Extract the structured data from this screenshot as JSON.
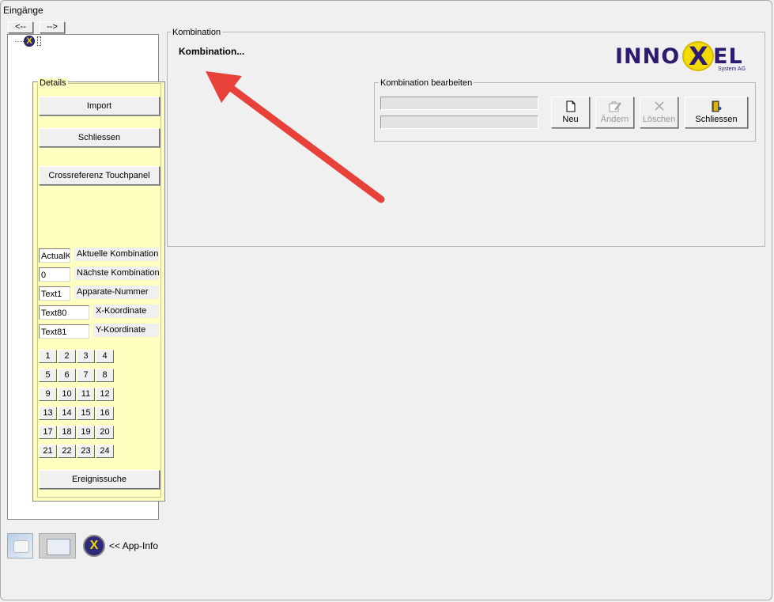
{
  "window": {
    "title": "Eingänge"
  },
  "nav": {
    "back_label": "<--",
    "forward_label": "-->"
  },
  "details": {
    "group_label": "Details",
    "import_label": "Import",
    "close_label": "Schliessen",
    "crossref_label": "Crossreferenz Touchpanel",
    "fields": [
      {
        "value": "ActualK",
        "label": "Aktuelle Kombination"
      },
      {
        "value": "0",
        "label": "Nächste Kombination"
      },
      {
        "value": "Text1",
        "label": "Apparate-Nummer"
      },
      {
        "value": "Text80",
        "label": "X-Koordinate"
      },
      {
        "value": "Text81",
        "label": "Y-Koordinate"
      }
    ],
    "number_buttons": [
      "1",
      "2",
      "3",
      "4",
      "5",
      "6",
      "7",
      "8",
      "9",
      "10",
      "11",
      "12",
      "13",
      "14",
      "15",
      "16",
      "17",
      "18",
      "19",
      "20",
      "21",
      "22",
      "23",
      "24"
    ],
    "event_search_label": "Ereignissuche"
  },
  "kombination": {
    "group_label": "Kombination",
    "heading": "Kombination...",
    "logo": {
      "left": "INNO",
      "mid": "X",
      "right": "EL",
      "sub": "System AG",
      "color": "#2e1a6e",
      "accent": "#f2dc00"
    },
    "edit": {
      "group_label": "Kombination bearbeiten",
      "buttons": [
        {
          "label": "Neu",
          "icon": "new-document-icon",
          "enabled": true
        },
        {
          "label": "Ändern",
          "icon": "edit-icon",
          "enabled": false
        },
        {
          "label": "Löschen",
          "icon": "delete-icon",
          "enabled": false
        },
        {
          "label": "Schliessen",
          "icon": "exit-door-icon",
          "enabled": true
        }
      ]
    }
  },
  "footer": {
    "app_info_label": "<< App-Info"
  },
  "annotation": {
    "arrow_color": "#e8413a"
  },
  "colors": {
    "details_bg": "#ffffc0"
  }
}
